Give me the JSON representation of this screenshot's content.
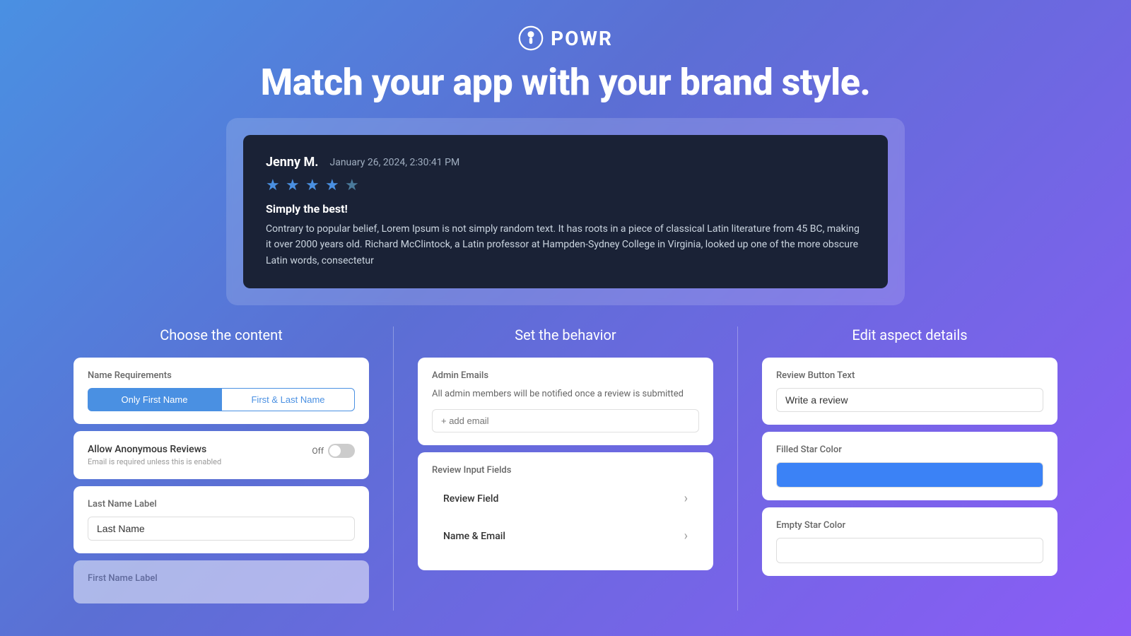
{
  "header": {
    "logo_text": "POWR",
    "headline": "Match your app with your brand style."
  },
  "review_card": {
    "reviewer_name": "Jenny M.",
    "review_date": "January 26, 2024, 2:30:41 PM",
    "stars": 4,
    "review_title": "Simply the best!",
    "review_body": "Contrary to popular belief, Lorem Ipsum is not simply random text. It has roots in a piece of classical Latin literature from 45 BC, making it over 2000 years old. Richard McClintock, a Latin professor at Hampden-Sydney College in Virginia, looked up one of the more obscure Latin words, consectetur"
  },
  "sections": {
    "content": {
      "title": "Choose the content",
      "name_requirements": {
        "label": "Name Requirements",
        "options": [
          "Only First Name",
          "First & Last Name"
        ],
        "selected": 0
      },
      "allow_anonymous": {
        "label": "Allow Anonymous Reviews",
        "sublabel": "Email is required unless this is enabled",
        "toggle_state": "Off"
      },
      "last_name_label": {
        "label": "Last Name Label",
        "value": "Last Name"
      },
      "first_name_label": {
        "label": "First Name Label"
      }
    },
    "behavior": {
      "title": "Set the behavior",
      "admin_emails": {
        "label": "Admin Emails",
        "description": "All admin members will be notified once a review is submitted",
        "placeholder": "+ add email"
      },
      "review_input_fields": {
        "label": "Review Input Fields",
        "fields": [
          {
            "name": "Review Field"
          },
          {
            "name": "Name & Email"
          }
        ]
      }
    },
    "aspect": {
      "title": "Edit aspect details",
      "review_button_text": {
        "label": "Review Button Text",
        "value": "Write a review"
      },
      "filled_star_color": {
        "label": "Filled Star Color",
        "color": "#3b82f6"
      },
      "empty_star_color": {
        "label": "Empty Star Color",
        "color": "#ffffff"
      }
    }
  }
}
